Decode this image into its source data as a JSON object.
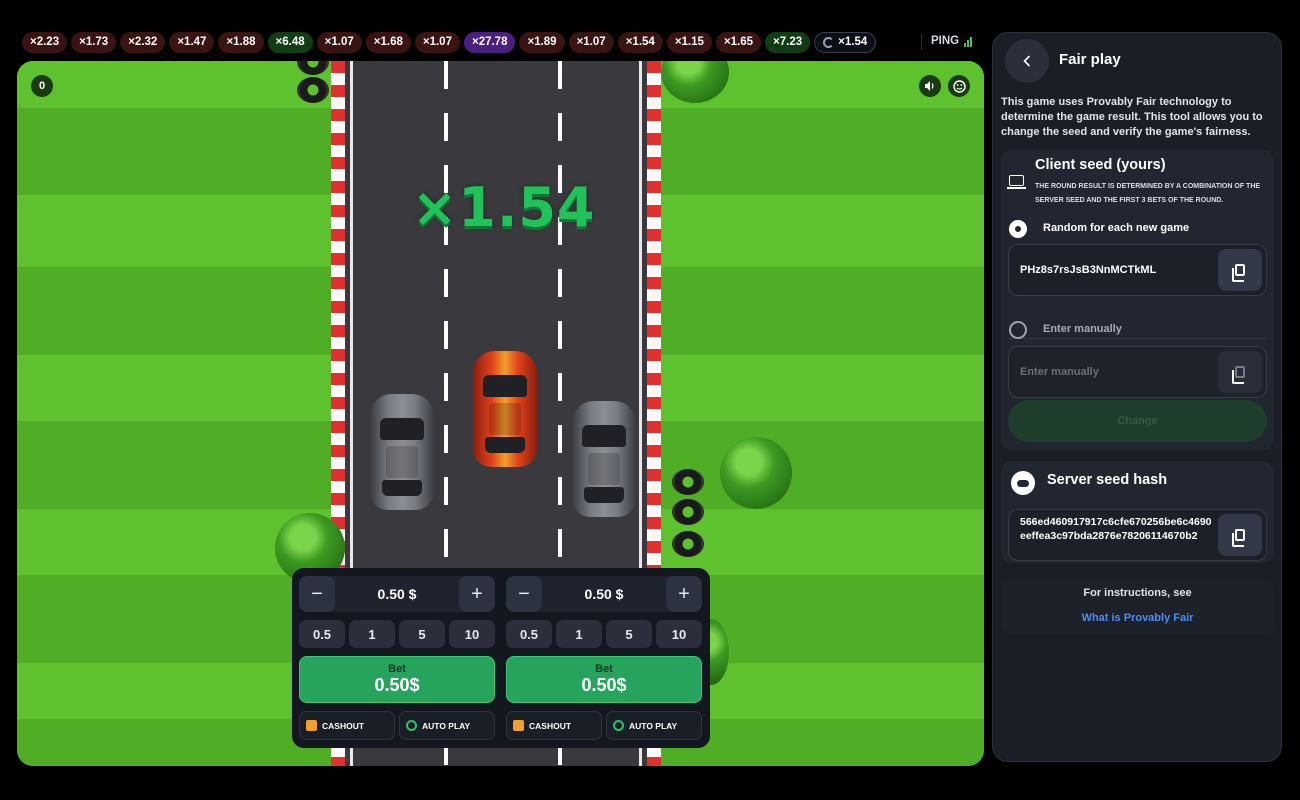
{
  "history": [
    {
      "label": "×2.23",
      "tier": "low"
    },
    {
      "label": "×1.73",
      "tier": "low"
    },
    {
      "label": "×2.32",
      "tier": "low"
    },
    {
      "label": "×1.47",
      "tier": "low"
    },
    {
      "label": "×1.88",
      "tier": "low"
    },
    {
      "label": "×6.48",
      "tier": "mid"
    },
    {
      "label": "×1.07",
      "tier": "low"
    },
    {
      "label": "×1.68",
      "tier": "low"
    },
    {
      "label": "×1.07",
      "tier": "low"
    },
    {
      "label": "×27.78",
      "tier": "high"
    },
    {
      "label": "×1.89",
      "tier": "low"
    },
    {
      "label": "×1.07",
      "tier": "low"
    },
    {
      "label": "×1.54",
      "tier": "low"
    },
    {
      "label": "×1.15",
      "tier": "low"
    },
    {
      "label": "×1.65",
      "tier": "low"
    },
    {
      "label": "×7.23",
      "tier": "mid"
    }
  ],
  "current_round": {
    "label": "×1.54"
  },
  "ping_label": "PING",
  "game": {
    "multiplier": "×1.54",
    "counter": "0",
    "sound_icon": "speaker-icon",
    "emoji_icon": "smiley-icon"
  },
  "bets": [
    {
      "amount": "0.50 $",
      "quick": [
        "0.5",
        "1",
        "5",
        "10"
      ],
      "bet_label": "Bet",
      "bet_value": "0.50$",
      "cashout_label": "CASHOUT",
      "autoplay_label": "AUTO PLAY"
    },
    {
      "amount": "0.50 $",
      "quick": [
        "0.5",
        "1",
        "5",
        "10"
      ],
      "bet_label": "Bet",
      "bet_value": "0.50$",
      "cashout_label": "CASHOUT",
      "autoplay_label": "AUTO PLAY"
    }
  ],
  "fair": {
    "title": "Fair play",
    "description": "This game uses Provably Fair technology to determine the game result. This tool allows you to change the seed and verify the game's fairness.",
    "client": {
      "title": "Client seed (yours)",
      "note": "The round result is determined by a combination of the server seed and the first 3 bets of the round.",
      "random_label": "Random for each new game",
      "seed": "PHz8s7rsJsB3NnMCTkML",
      "manual_label": "Enter manually",
      "manual_placeholder": "Enter manually",
      "change_label": "Change"
    },
    "server": {
      "title": "Server seed hash",
      "hash": "566ed460917917c6cfe670256be6c4690eeffea3c97bda2876e78206114670b2"
    },
    "info_text": "For instructions, see",
    "info_link": "What is Provably Fair"
  },
  "colors": {
    "multiplier": "#22c25a",
    "bet_button": "#26a35c",
    "link": "#4b8cf6",
    "low_pill": "#3a1313",
    "mid_pill": "#113d14",
    "high_pill": "#4a1f80"
  }
}
